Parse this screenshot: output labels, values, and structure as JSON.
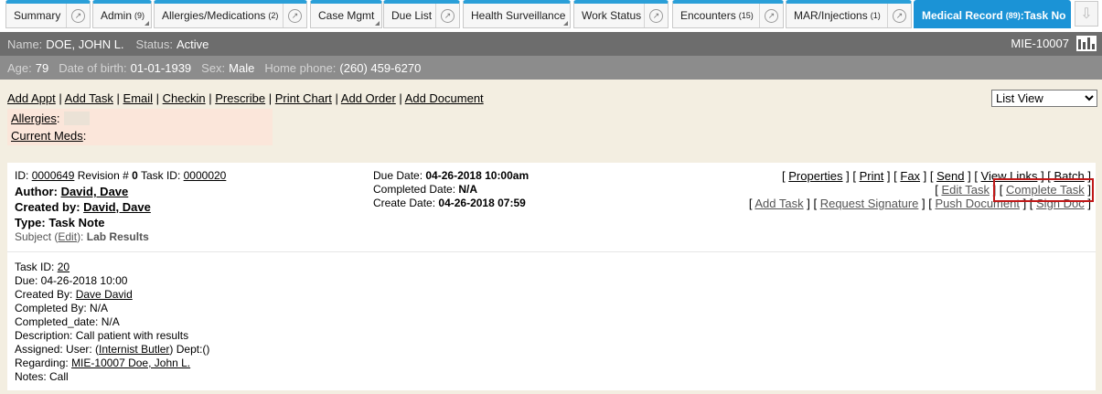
{
  "tabs": [
    {
      "label": "Summary",
      "count": ""
    },
    {
      "label": "Admin",
      "count": "(9)"
    },
    {
      "label": "Allergies/Medications",
      "count": "(2)"
    },
    {
      "label": "Case Mgmt",
      "count": ""
    },
    {
      "label": "Due List",
      "count": ""
    },
    {
      "label": "Health Surveillance",
      "count": ""
    },
    {
      "label": "Work Status",
      "count": ""
    },
    {
      "label": "Encounters",
      "count": "(15)"
    },
    {
      "label": "MAR/Injections",
      "count": "(1)"
    },
    {
      "label": "Medical Record",
      "count": "(89)",
      "suffix": ":Task No"
    }
  ],
  "patient": {
    "name_label": "Name:",
    "name": "DOE, JOHN L.",
    "status_label": "Status:",
    "status": "Active",
    "mrn": "MIE-10007",
    "age_label": "Age:",
    "age": "79",
    "dob_label": "Date of birth:",
    "dob": "01-01-1939",
    "sex_label": "Sex:",
    "sex": "Male",
    "phone_label": "Home phone:",
    "phone": "(260) 459-6270"
  },
  "actions": [
    "Add Appt",
    "Add Task",
    "Email",
    "Checkin",
    "Prescribe",
    "Print Chart",
    "Add Order",
    "Add Document"
  ],
  "view_select": {
    "selected": "List View"
  },
  "allergies": {
    "allergies_label": "Allergies",
    "meds_label": "Current Meds"
  },
  "document": {
    "id_label": "ID:",
    "id": "0000649",
    "revision_label": "Revision #",
    "revision": "0",
    "task_id_label": "Task ID:",
    "task_id": "0000020",
    "author_label": "Author:",
    "author": "David, Dave",
    "created_by_label": "Created by:",
    "created_by": "David, Dave",
    "type_label": "Type:",
    "type": "Task Note",
    "subject_label": "Subject",
    "subject_edit": "Edit",
    "subject": "Lab Results",
    "due_label": "Due Date:",
    "due": "04-26-2018 10:00am",
    "completed_label": "Completed Date:",
    "completed": "N/A",
    "create_label": "Create Date:",
    "create": "04-26-2018 07:59",
    "links_row1": [
      "Properties",
      "Print",
      "Fax",
      "Send",
      "View Links",
      "Batch"
    ],
    "links_row2": [
      "Edit Task",
      "Complete Task"
    ],
    "links_row3": [
      "Add Task",
      "Request Signature",
      "Push Document",
      "Sign Doc"
    ]
  },
  "body": {
    "task_id_label": "Task ID:",
    "task_id": "20",
    "due": "Due: 04-26-2018 10:00",
    "created_by_label": "Created By:",
    "created_by": "Dave David",
    "completed_by": "Completed By: N/A",
    "completed_date": "Completed_date: N/A",
    "description": "Description: Call patient with results",
    "assigned_prefix": "Assigned: User: (",
    "assigned_user": "Internist Butler",
    "assigned_suffix": ") Dept:()",
    "regarding_label": "Regarding:",
    "regarding": "MIE-10007 Doe, John L.",
    "notes": "Notes: Call"
  }
}
